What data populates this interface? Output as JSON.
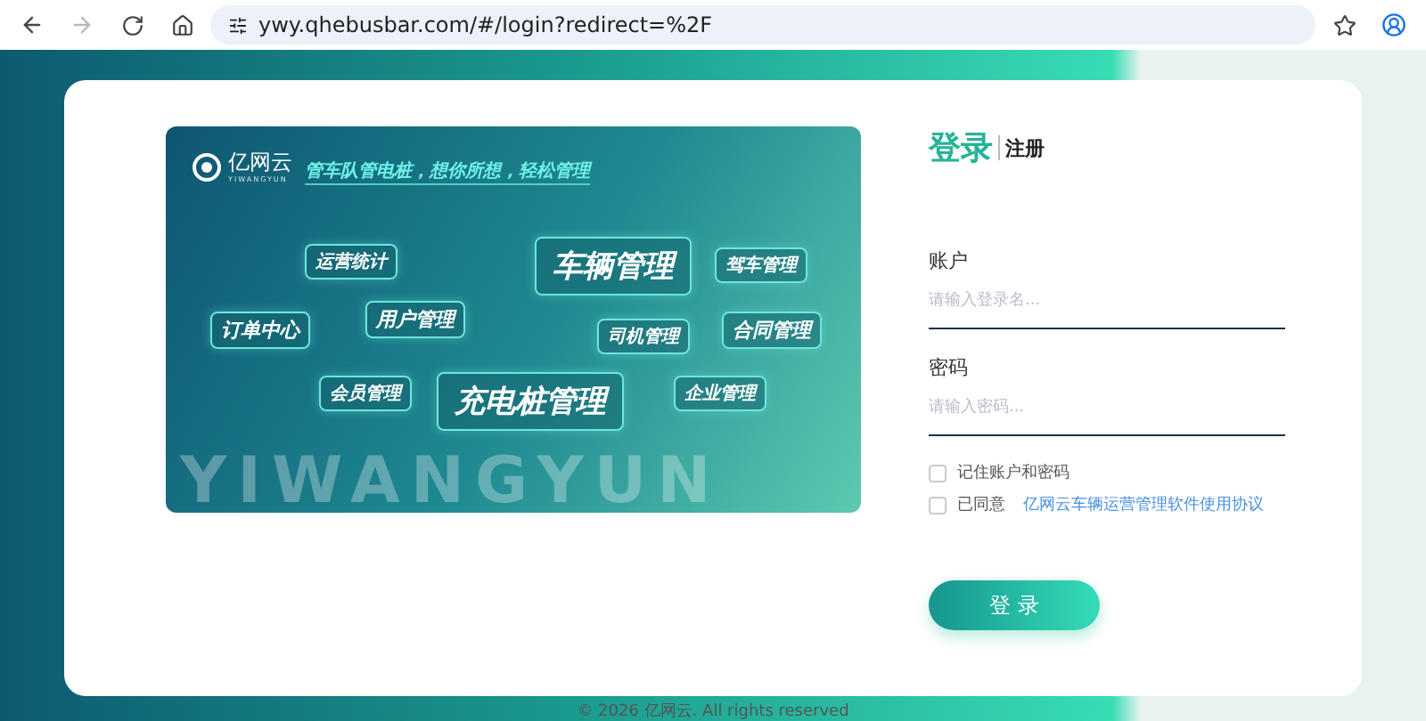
{
  "browser": {
    "url": "ywy.qhebusbar.com/#/login?redirect=%2F",
    "forward_disabled": true
  },
  "banner": {
    "logo_text": "亿网云",
    "logo_subtext": "YIWANGYUN",
    "tagline": "管车队管电桩，想你所想，轻松管理",
    "backdrop_text": "YIWANGYUN",
    "nodes": [
      {
        "label": "运营统计"
      },
      {
        "label": "车辆管理"
      },
      {
        "label": "驾车管理"
      },
      {
        "label": "订单中心"
      },
      {
        "label": "用户管理"
      },
      {
        "label": "司机管理"
      },
      {
        "label": "合同管理"
      },
      {
        "label": "会员管理"
      },
      {
        "label": "充电桩管理"
      },
      {
        "label": "企业管理"
      }
    ]
  },
  "form": {
    "tabs": [
      {
        "label": "登录",
        "selected": true
      },
      {
        "label": "注册",
        "selected": false
      }
    ],
    "fields": [
      {
        "label": "账户",
        "placeholder": "请输入登录名..."
      },
      {
        "label": "密码",
        "placeholder": "请输入密码..."
      }
    ],
    "remember": {
      "label": "记住账户和密码",
      "checked": false
    },
    "agree": {
      "label": "已同意",
      "link": "亿网云车辆运营管理软件使用协议",
      "checked": false
    },
    "submit": "登 录"
  },
  "footer": "© 2026 亿网云. All rights reserved"
}
